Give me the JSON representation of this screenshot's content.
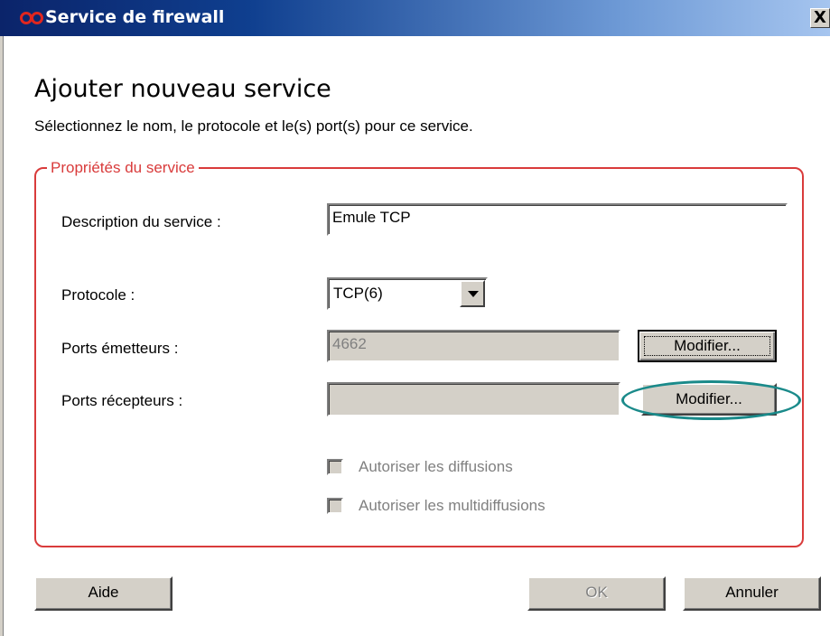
{
  "window": {
    "title": "Service de firewall",
    "close_label": "X"
  },
  "header": {
    "title": "Ajouter nouveau service",
    "subtitle": "Sélectionnez le nom, le protocole et le(s) port(s) pour ce service."
  },
  "group": {
    "legend": "Propriétés du service",
    "description": {
      "label": "Description du service :",
      "value": "Emule TCP"
    },
    "protocol": {
      "label": "Protocole :",
      "value": "TCP(6)"
    },
    "source_ports": {
      "label": "Ports émetteurs :",
      "value": "4662",
      "button": "Modifier..."
    },
    "dest_ports": {
      "label": "Ports récepteurs :",
      "value": "",
      "button": "Modifier..."
    },
    "allow_broadcast": {
      "label": "Autoriser les diffusions",
      "checked": false,
      "enabled": false
    },
    "allow_multicast": {
      "label": "Autoriser les multidiffusions",
      "checked": false,
      "enabled": false
    }
  },
  "footer": {
    "help_label": "Aide",
    "ok_label": "OK",
    "cancel_label": "Annuler"
  },
  "colors": {
    "group_border": "#d93b3b",
    "highlight": "#1a8a8a",
    "titlebar": "#0b246a"
  }
}
